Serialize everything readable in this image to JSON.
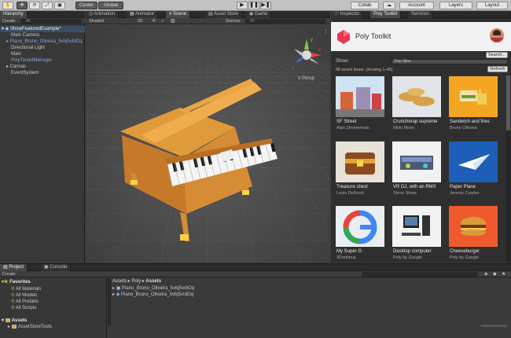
{
  "toolbar": {
    "center": "Center",
    "global": "Global",
    "collab": "Collab",
    "account": "Account",
    "layers": "Layers",
    "layout": "Layout",
    "play": "▶",
    "pause": "❚❚",
    "step": "▶❚"
  },
  "hierarchy": {
    "tab": "Hierarchy",
    "create": "Create",
    "search": "All",
    "items": [
      {
        "label": "ShowFeaturedExample*"
      },
      {
        "label": "Main Camera"
      },
      {
        "label": "Piano_Bruno_Oliveira_5vbj5vIdOq"
      },
      {
        "label": "Directional Light"
      },
      {
        "label": "Main"
      },
      {
        "label": "PolyToolkitManager"
      },
      {
        "label": "Canvas"
      },
      {
        "label": "EventSystem"
      }
    ]
  },
  "center": {
    "tabs": [
      "Animation",
      "Animator",
      "Scene",
      "Asset Store",
      "Game"
    ],
    "shaded": "Shaded",
    "mode2d": "2D",
    "gizmos": "Gizmos",
    "search": "All",
    "persp": "Persp",
    "gizmo_axes": {
      "x": "x",
      "y": "y",
      "z": "z"
    }
  },
  "inspector": {
    "tabs": [
      "Inspector",
      "Poly Toolkit",
      "Services"
    ]
  },
  "poly": {
    "title": "Poly Toolkit",
    "search_button": "Search...",
    "show_label": "Show:",
    "show_value": "Your likes",
    "status": "88 assets found. (showing 1–45).",
    "refresh": "Refresh",
    "assets": [
      {
        "title": "SF Street",
        "author": "Alan Zimmerman"
      },
      {
        "title": "Cruncherap supreme",
        "author": "Nikki Morin"
      },
      {
        "title": "Sandwich and fries",
        "author": "Bruno Oliveira"
      },
      {
        "title": "Treasure chest",
        "author": "Louis DeScioli"
      },
      {
        "title": "VR DJ, with an RMX",
        "author": "Steve Stone"
      },
      {
        "title": "Paper Plane",
        "author": "Jeremy Cowles"
      },
      {
        "title": "My Super G",
        "author": "3Donimus"
      },
      {
        "title": "Desktop computer",
        "author": "Poly by Google"
      },
      {
        "title": "Cheeseburger",
        "author": "Poly by Google"
      }
    ]
  },
  "project": {
    "tabs": [
      "Project",
      "Console"
    ],
    "create": "Create",
    "favorites": {
      "label": "Favorites",
      "items": [
        "All Materials",
        "All Models",
        "All Prefabs",
        "All Scripts"
      ]
    },
    "assets_label": "Assets",
    "asset_tree": [
      "AssetStoreTools"
    ],
    "breadcrumb": [
      "Assets",
      "Poly",
      "Assets"
    ],
    "files": [
      "Piano_Bruno_Oliveira_5vbj5vIdOq",
      "Piano_Bruno_Oliveira_5vbj5vIdOq"
    ]
  }
}
